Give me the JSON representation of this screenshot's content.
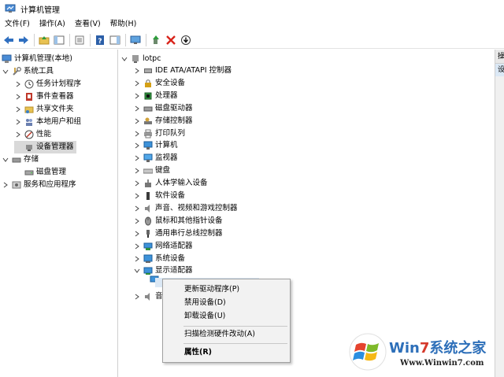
{
  "window": {
    "title": "计算机管理"
  },
  "menubar": {
    "items": [
      "文件(F)",
      "操作(A)",
      "查看(V)",
      "帮助(H)"
    ]
  },
  "toolbar": {
    "buttons": [
      "back-icon",
      "forward-icon",
      "up-folder-icon",
      "show-hide-tree-icon",
      "properties-icon",
      "help-icon",
      "action-pane-icon",
      "monitor-icon",
      "scan-hardware-icon",
      "uninstall-icon",
      "update-driver-icon"
    ]
  },
  "tree": {
    "root": "计算机管理(本地)",
    "items": [
      {
        "label": "系统工具",
        "icon": "tools-icon"
      },
      {
        "label": "任务计划程序",
        "icon": "clock-icon"
      },
      {
        "label": "事件查看器",
        "icon": "event-viewer-icon"
      },
      {
        "label": "共享文件夹",
        "icon": "shared-folder-icon"
      },
      {
        "label": "本地用户和组",
        "icon": "users-icon"
      },
      {
        "label": "性能",
        "icon": "performance-icon"
      },
      {
        "label": "设备管理器",
        "icon": "device-manager-icon"
      },
      {
        "label": "存储",
        "icon": "storage-icon"
      },
      {
        "label": "磁盘管理",
        "icon": "disk-icon"
      },
      {
        "label": "服务和应用程序",
        "icon": "services-icon"
      }
    ]
  },
  "devices": {
    "computer": "lotpc",
    "categories": [
      "IDE ATA/ATAPI 控制器",
      "安全设备",
      "处理器",
      "磁盘驱动器",
      "存储控制器",
      "打印队列",
      "计算机",
      "监视器",
      "键盘",
      "人体学输入设备",
      "软件设备",
      "声音、视频和游戏控制器",
      "鼠标和其他指针设备",
      "通用串行总线控制器",
      "网络适配器",
      "系统设备",
      "显示适配器"
    ],
    "partial_label": "音"
  },
  "context_menu": {
    "items": [
      "更新驱动程序(P)",
      "禁用设备(D)",
      "卸载设备(U)",
      "扫描检测硬件改动(A)",
      "属性(R)"
    ]
  },
  "actions_pane": {
    "header": "操",
    "sub": "设"
  },
  "watermark": {
    "brand_prefix": "Win",
    "brand_seven": "7",
    "brand_suffix": "系统之家",
    "url": "Www.Winwin7.com"
  },
  "colors": {
    "selection": "#d9d9d9",
    "hover": "#dbe8f5",
    "brand_blue": "#2d6fb9",
    "brand_red": "#d5392b",
    "uninstall_red": "#d9241b"
  }
}
